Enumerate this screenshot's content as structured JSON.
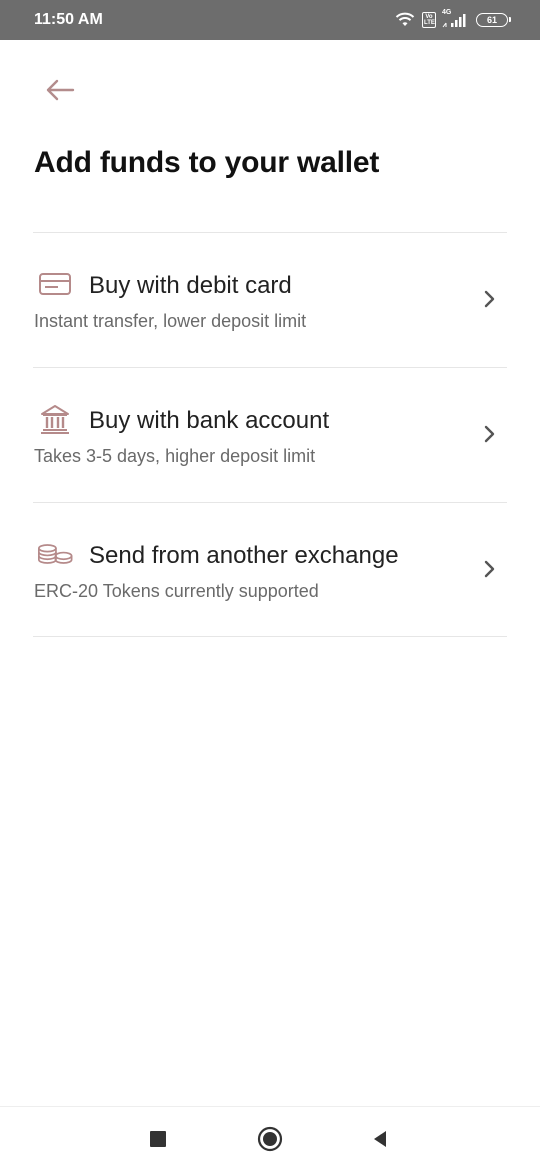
{
  "status_bar": {
    "time": "11:50 AM",
    "volte_label": "Vo LTE",
    "network_label": "4G",
    "battery_level": "61"
  },
  "header": {
    "title": "Add funds to your wallet"
  },
  "options": [
    {
      "title": "Buy with debit card",
      "subtitle": "Instant transfer, lower deposit limit",
      "icon": "debit-card-icon"
    },
    {
      "title": "Buy with bank account",
      "subtitle": "Takes 3-5 days, higher deposit limit",
      "icon": "bank-icon"
    },
    {
      "title": "Send from another exchange",
      "subtitle": "ERC-20 Tokens currently supported",
      "icon": "coins-icon"
    }
  ],
  "colors": {
    "accent_icon": "#b58a8a",
    "title_text": "#111111",
    "subtitle_text": "#6a6a6a",
    "divider": "#e6e6e6",
    "status_bar_bg": "#6d6d6d"
  }
}
